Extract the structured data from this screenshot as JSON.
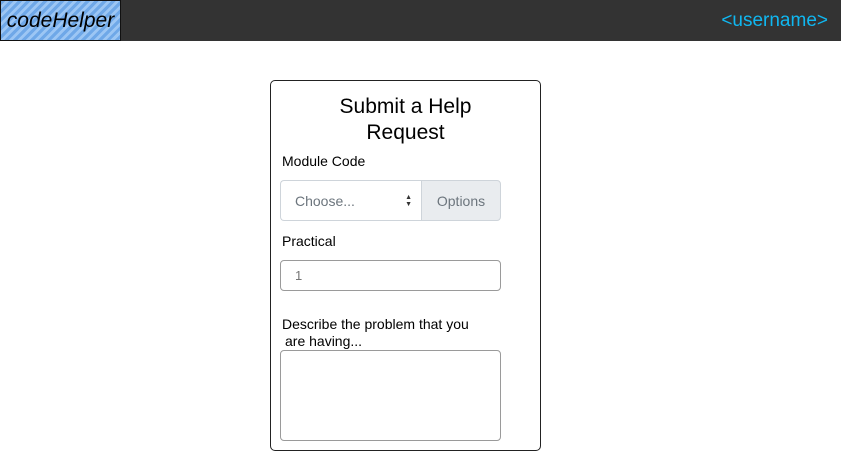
{
  "header": {
    "logo_text": "codeHelper",
    "username": "<username>"
  },
  "form": {
    "title_line1": "Submit a Help",
    "title_line2": "Request",
    "module_label": "Module Code",
    "module_select_value": "Choose...",
    "options_label": "Options",
    "practical_label": "Practical",
    "practical_placeholder": "1",
    "description_label_line1": "Describe the problem that you",
    "description_label_line2": "are having...",
    "description_value": ""
  },
  "colors": {
    "topbar": "#333333",
    "username": "#10b7f0",
    "logo_stripe_1": "#6fa8e8",
    "logo_stripe_2": "#9cc6f4",
    "addon_bg": "#e9ecef"
  }
}
